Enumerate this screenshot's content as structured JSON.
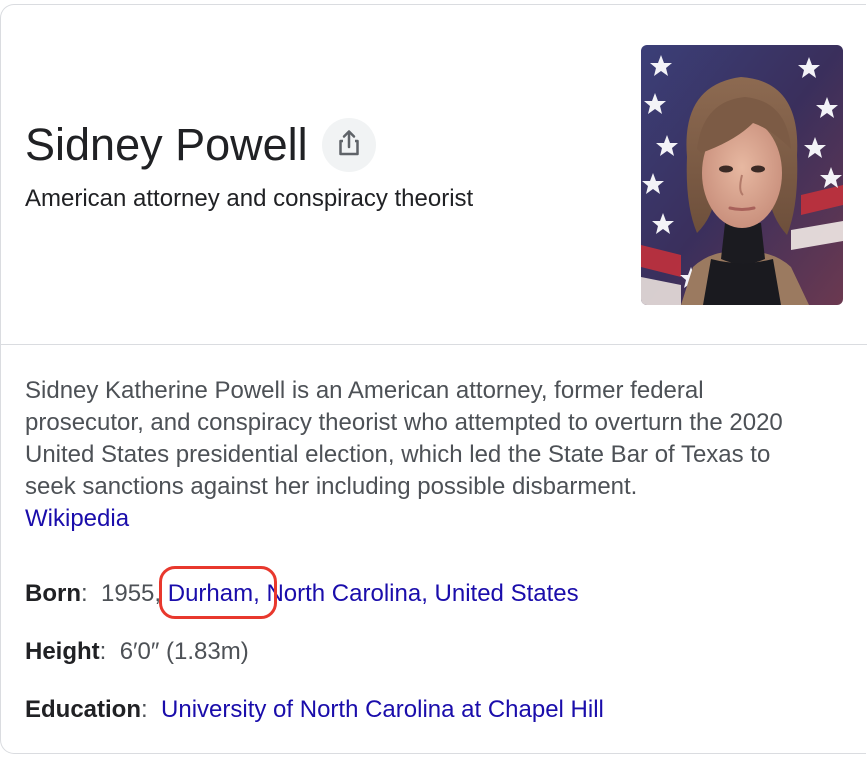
{
  "entity": {
    "name": "Sidney Powell",
    "description": "American attorney and conspiracy theorist",
    "share_icon": "share-icon",
    "photo_alt": "Sidney Powell photo"
  },
  "summary": {
    "text": "Sidney Katherine Powell is an American attorney, former federal prosecutor, and conspiracy theorist who attempted to overturn the 2020 United States presidential election, which led the State Bar of Texas to seek sanctions against her including possible disbarment.",
    "source_link": "Wikipedia"
  },
  "facts": {
    "born": {
      "label": "Born",
      "year": "1955,",
      "city_link": "Durham,",
      "region_link": "North Carolina, United States"
    },
    "height": {
      "label": "Height",
      "value": "6′0″ (1.83m)"
    },
    "education": {
      "label": "Education",
      "value_link": "University of North Carolina at Chapel Hill"
    }
  },
  "colors": {
    "link": "#1a0dab",
    "text": "#202124",
    "secondary_text": "#4d5156",
    "annotation": "#e8382d",
    "border": "#dadce0"
  }
}
